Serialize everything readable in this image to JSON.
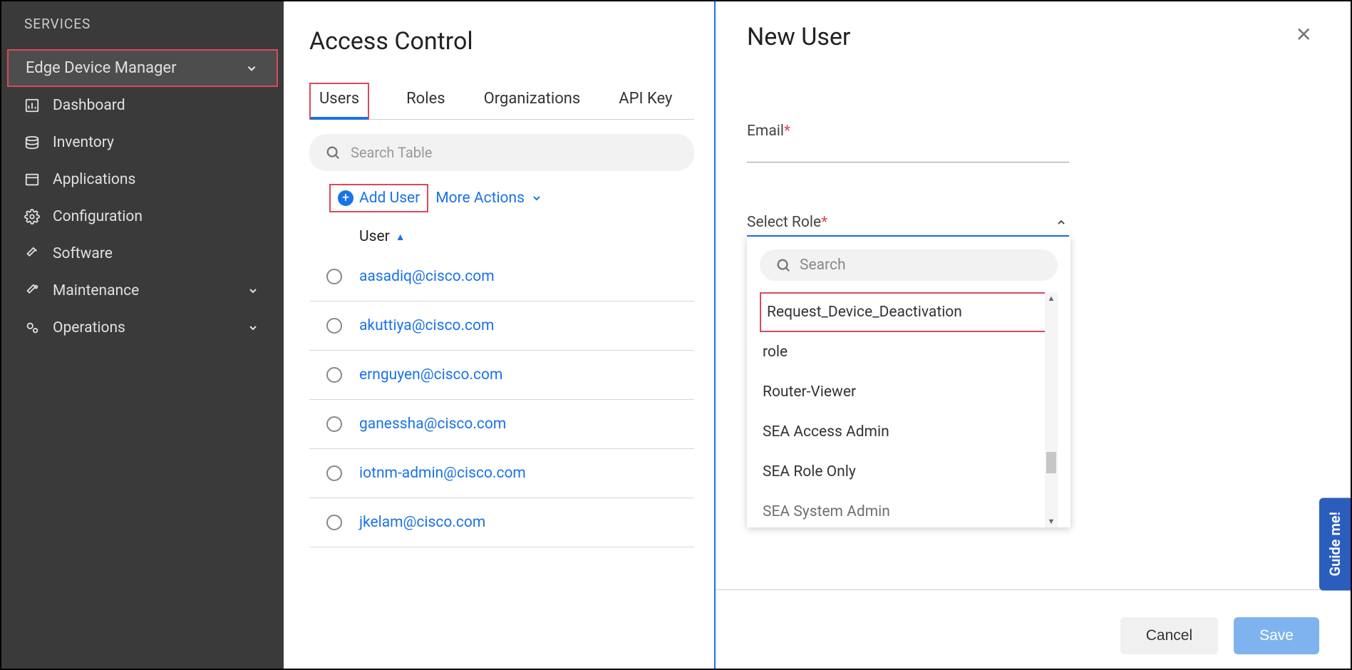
{
  "sidebar": {
    "header": "SERVICES",
    "section": "Edge Device Manager",
    "items": [
      {
        "label": "Dashboard",
        "icon": "dashboard-icon"
      },
      {
        "label": "Inventory",
        "icon": "inventory-icon"
      },
      {
        "label": "Applications",
        "icon": "applications-icon"
      },
      {
        "label": "Configuration",
        "icon": "configuration-icon"
      },
      {
        "label": "Software",
        "icon": "software-icon"
      },
      {
        "label": "Maintenance",
        "icon": "maintenance-icon",
        "expandable": true
      },
      {
        "label": "Operations",
        "icon": "operations-icon",
        "expandable": true
      }
    ]
  },
  "page": {
    "title": "Access Control",
    "tabs": [
      "Users",
      "Roles",
      "Organizations",
      "API Key"
    ],
    "search_placeholder": "Search Table",
    "add_user": "Add User",
    "more_actions": "More Actions",
    "col_header": "User"
  },
  "users": [
    "aasadiq@cisco.com",
    "akuttiya@cisco.com",
    "ernguyen@cisco.com",
    "ganessha@cisco.com",
    "iotnm-admin@cisco.com",
    "jkelam@cisco.com"
  ],
  "panel": {
    "title": "New User",
    "email_label": "Email",
    "role_label": "Select Role",
    "dd_search_placeholder": "Search",
    "roles": [
      "Request_Device_Deactivation",
      "role",
      "Router-Viewer",
      "SEA Access Admin",
      "SEA Role Only",
      "SEA System Admin"
    ],
    "cancel": "Cancel",
    "save": "Save"
  },
  "guide": "Guide me!"
}
